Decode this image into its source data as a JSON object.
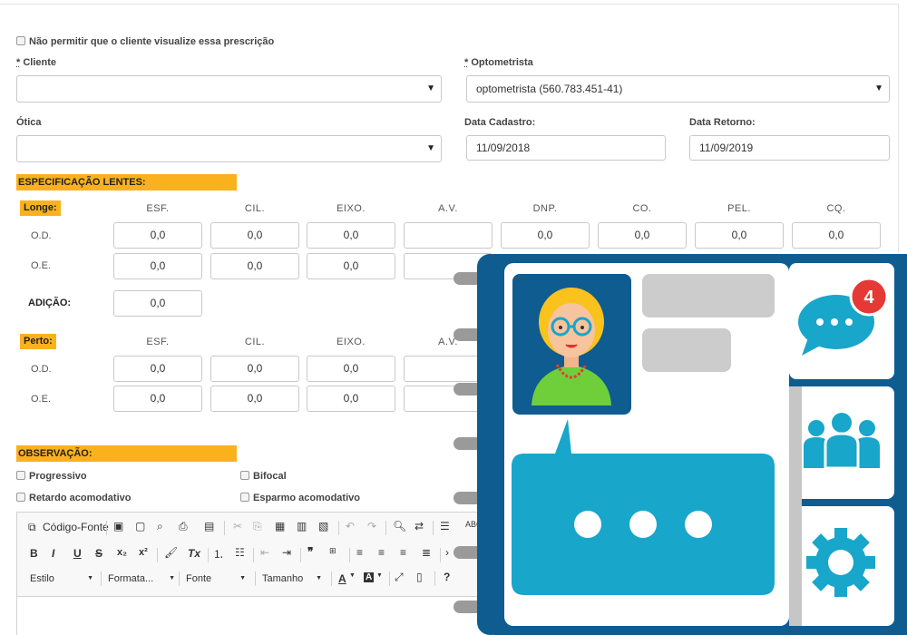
{
  "form": {
    "no_view_label": "Não permitir que o cliente visualize essa prescrição",
    "required_mark": "*",
    "cliente_label": "Cliente",
    "cliente_value": "",
    "optometrista_label": "Optometrista",
    "optometrista_value": "optometrista (560.783.451-41)",
    "otica_label": "Ótica",
    "otica_value": "",
    "data_cadastro_label": "Data Cadastro:",
    "data_cadastro_value": "11/09/2018",
    "data_retorno_label": "Data Retorno:",
    "data_retorno_value": "11/09/2019"
  },
  "lentes": {
    "section_title": "ESPECIFICAÇÃO LENTES:",
    "longe_tag": "Longe:",
    "perto_tag": "Perto:",
    "columns": [
      "ESF.",
      "CIL.",
      "EIXO.",
      "A.V.",
      "DNP.",
      "CO.",
      "PEL.",
      "CQ."
    ],
    "row_od": "O.D.",
    "row_oe": "O.E.",
    "adicao_label": "ADIÇÃO:",
    "longe_od": [
      "0,0",
      "0,0",
      "0,0",
      "",
      "0,0",
      "0,0",
      "0,0",
      "0,0"
    ],
    "longe_oe": [
      "0,0",
      "0,0",
      "0,0"
    ],
    "adicao_value": "0,0",
    "perto_od": [
      "0,0",
      "0,0",
      "0,0"
    ],
    "perto_oe": [
      "0,0",
      "0,0",
      "0,0"
    ]
  },
  "observacao": {
    "section_title": "OBSERVAÇÃO:",
    "progressivo": "Progressivo",
    "bifocal": "Bifocal",
    "retardo": "Retardo acomodativo",
    "esparmo": "Esparmo acomodativo"
  },
  "editor": {
    "codigo_fonte": "Código-Fonte",
    "estilo": "Estilo",
    "formatacao": "Formata...",
    "fonte": "Fonte",
    "tamanho": "Tamanho",
    "bold": "B",
    "italic": "I",
    "underline": "U",
    "strike": "S",
    "subscript": "x₂",
    "superscript": "x²",
    "remove_format": "Tx",
    "quote": "❞",
    "help": "?",
    "font_color": "A",
    "bg_color": "A",
    "abc": "ABC"
  },
  "badge": {
    "count": "4"
  },
  "colors": {
    "accent": "#f9b21d",
    "illus_dark_blue": "#0f5c91",
    "illus_cyan": "#18a6cb",
    "badge_red": "#e53935"
  }
}
